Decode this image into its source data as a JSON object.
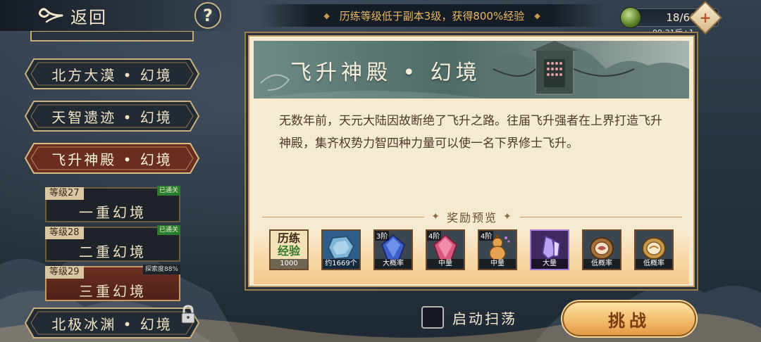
{
  "nav": {
    "back_label": "返回",
    "help_label": "?"
  },
  "notice": {
    "text": "历练等级低于副本3级，获得800%经验"
  },
  "stamina": {
    "value": "18/60",
    "add_label": "+",
    "timer": "09:21后+1"
  },
  "regions": [
    {
      "label": "北方大漠 • 幻境",
      "active": false
    },
    {
      "label": "天智遗迹 • 幻境",
      "active": false
    },
    {
      "label": "飞升神殿 • 幻境",
      "active": true
    },
    {
      "label": "北极冰渊 • 幻境",
      "active": false,
      "locked": true
    }
  ],
  "floors": [
    {
      "level": "等级27",
      "name": "一重幻境",
      "status": "已通关"
    },
    {
      "level": "等级28",
      "name": "二重幻境",
      "status": "已通关"
    },
    {
      "level": "等级29",
      "name": "三重幻境",
      "status": "探索度88%"
    }
  ],
  "panel": {
    "title": "飞升神殿 • 幻境",
    "description": "无数年前，天元大陆因故断绝了飞升之路。往届飞升强者在上界打造飞升神殿，集齐权势力智四种力量可以使一名下界修士飞升。",
    "reward_title": "奖励预览"
  },
  "rewards": [
    {
      "icon": "exp-scroll-icon",
      "label_line1": "历练",
      "label_line2": "经验",
      "qty": "1000",
      "tier": ""
    },
    {
      "icon": "spirit-stone-icon",
      "qty": "约1669个",
      "tier": ""
    },
    {
      "icon": "blue-crystal-icon",
      "qty": "大概率",
      "tier": "3阶"
    },
    {
      "icon": "pink-crystal-icon",
      "qty": "中量",
      "tier": "4阶"
    },
    {
      "icon": "gourd-icon",
      "qty": "中量",
      "tier": "4阶"
    },
    {
      "icon": "purple-crystal-icon",
      "qty": "大量",
      "tier": ""
    },
    {
      "icon": "bronze-medallion-icon",
      "qty": "低概率",
      "tier": ""
    },
    {
      "icon": "gold-medallion-icon",
      "qty": "低概率",
      "tier": ""
    }
  ],
  "bottom": {
    "sweep_label": "启动扫荡",
    "challenge_label": "挑战"
  }
}
